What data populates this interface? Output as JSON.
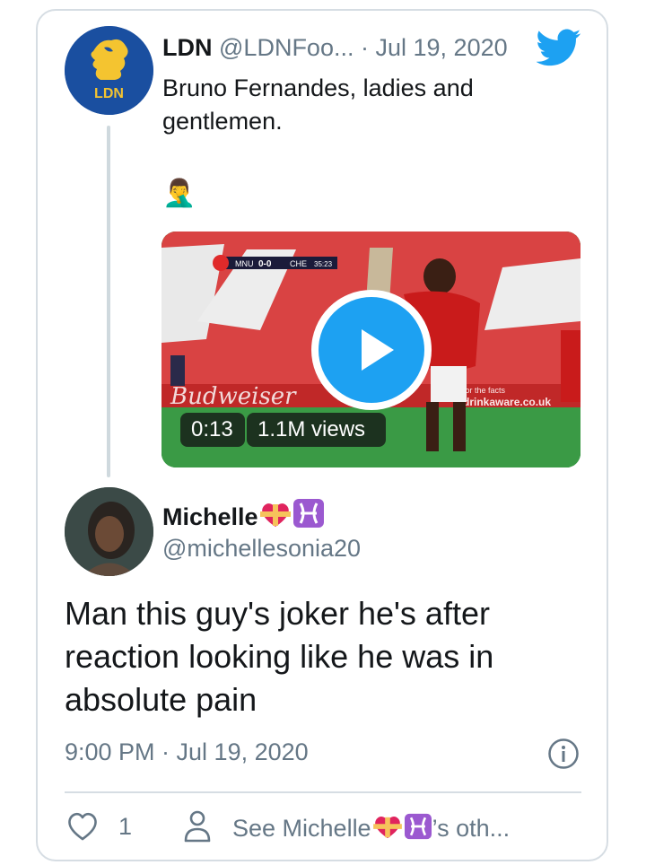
{
  "parent_tweet": {
    "display_name": "LDN",
    "handle": "@LDNFoo...",
    "separator": "·",
    "date": "Jul 19, 2020",
    "text": "Bruno Fernandes, ladies and gentlemen.",
    "emoji": "🤦‍♂️",
    "avatar_label": "LDN",
    "media": {
      "scoreboard_home": "MNU",
      "scoreboard_score": "0-0",
      "scoreboard_away": "CHE",
      "scoreboard_time": "35:23",
      "ad_small": "for the facts",
      "ad_site": "drinkaware.co.uk",
      "duration": "0:13",
      "views": "1.1M views"
    }
  },
  "reply": {
    "display_name": "Michelle",
    "handle": "@michellesonia20",
    "text": "Man this guy's joker he's after reaction looking like he was in absolute pain",
    "timestamp": "9:00 PM · Jul 19, 2020",
    "like_count": "1",
    "see_others_prefix": "See Michelle",
    "see_others_suffix": "’s oth..."
  },
  "colors": {
    "accent": "#1da1f2",
    "secondary_text": "#657786",
    "pitch_green": "#2f8a3b",
    "stand_red": "#d94343"
  },
  "icons": [
    "twitter-bird-icon",
    "play-icon",
    "info-icon",
    "heart-icon",
    "person-icon",
    "heart-ribbon-emoji",
    "pisces-emoji"
  ]
}
